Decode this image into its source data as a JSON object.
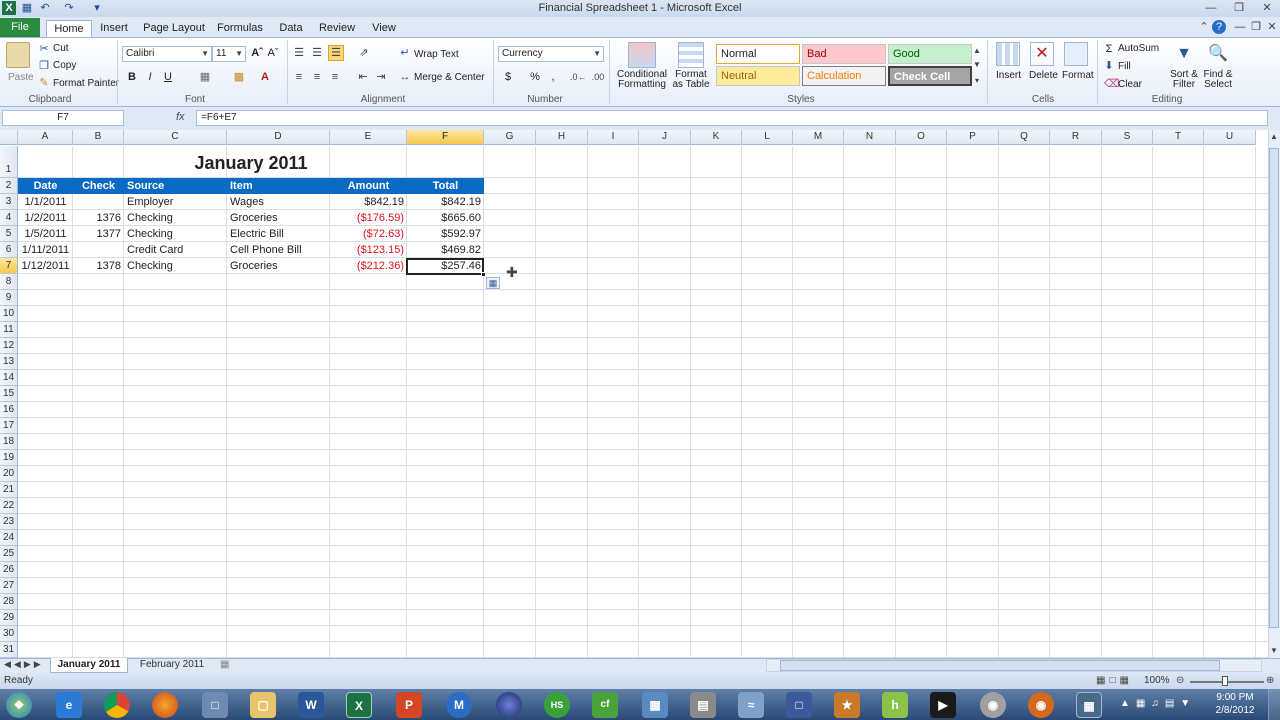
{
  "window": {
    "title": "Financial Spreadsheet 1 - Microsoft Excel"
  },
  "quick_access": {
    "save_icon": "save-icon",
    "undo_icon": "undo-icon",
    "redo_icon": "redo-icon"
  },
  "tabs": [
    {
      "label": "File"
    },
    {
      "label": "Home"
    },
    {
      "label": "Insert"
    },
    {
      "label": "Page Layout"
    },
    {
      "label": "Formulas"
    },
    {
      "label": "Data"
    },
    {
      "label": "Review"
    },
    {
      "label": "View"
    }
  ],
  "ribbon": {
    "clipboard": {
      "paste": "Paste",
      "cut": "Cut",
      "copy": "Copy",
      "format_painter": "Format Painter",
      "label": "Clipboard"
    },
    "font": {
      "name": "Calibri",
      "size": "11",
      "bold": "B",
      "italic": "I",
      "underline": "U",
      "label": "Font"
    },
    "alignment": {
      "wrap_text": "Wrap Text",
      "merge_center": "Merge & Center",
      "label": "Alignment"
    },
    "number": {
      "format": "Currency",
      "currency_symbol": "$",
      "percent": "%",
      "comma": ",",
      "label": "Number"
    },
    "styles": {
      "conditional_formatting": "Conditional Formatting",
      "format_as_table": "Format as Table",
      "normal": "Normal",
      "bad": "Bad",
      "good": "Good",
      "neutral": "Neutral",
      "calculation": "Calculation",
      "check_cell": "Check Cell",
      "label": "Styles"
    },
    "cells": {
      "insert": "Insert",
      "delete": "Delete",
      "format": "Format",
      "label": "Cells"
    },
    "editing": {
      "autosum": "AutoSum",
      "fill": "Fill",
      "clear": "Clear",
      "sort_filter": "Sort & Filter",
      "find_select": "Find & Select",
      "label": "Editing"
    }
  },
  "formula_bar": {
    "name_box": "F7",
    "fx": "fx",
    "formula": "=F6+E7"
  },
  "columns": [
    "A",
    "B",
    "C",
    "D",
    "E",
    "F",
    "G",
    "H",
    "I",
    "J",
    "K",
    "L",
    "M",
    "N",
    "O",
    "P",
    "Q",
    "R",
    "S",
    "T",
    "U"
  ],
  "rows": [
    "1",
    "2",
    "3",
    "4",
    "5",
    "6",
    "7",
    "8",
    "9",
    "10",
    "11",
    "12",
    "13",
    "14",
    "15",
    "16",
    "17",
    "18",
    "19",
    "20",
    "21",
    "22",
    "23",
    "24",
    "25",
    "26",
    "27",
    "28",
    "29",
    "30",
    "31"
  ],
  "sheet": {
    "title": "January 2011",
    "headers": [
      "Date",
      "Check",
      "Source",
      "Item",
      "Amount",
      "Total"
    ],
    "rows": [
      {
        "date": "1/1/2011",
        "check": "",
        "source": "Employer",
        "item": "Wages",
        "amount": "$842.19",
        "total": "$842.19",
        "negative": false
      },
      {
        "date": "1/2/2011",
        "check": "1376",
        "source": "Checking",
        "item": "Groceries",
        "amount": "($176.59)",
        "total": "$665.60",
        "negative": true
      },
      {
        "date": "1/5/2011",
        "check": "1377",
        "source": "Checking",
        "item": "Electric Bill",
        "amount": "($72.63)",
        "total": "$592.97",
        "negative": true
      },
      {
        "date": "1/11/2011",
        "check": "",
        "source": "Credit Card",
        "item": "Cell Phone Bill",
        "amount": "($123.15)",
        "total": "$469.82",
        "negative": true
      },
      {
        "date": "1/12/2011",
        "check": "1378",
        "source": "Checking",
        "item": "Groceries",
        "amount": "($212.36)",
        "total": "$257.46",
        "negative": true
      }
    ]
  },
  "sheet_tabs": [
    {
      "label": "January 2011"
    },
    {
      "label": "February 2011"
    }
  ],
  "status": {
    "ready": "Ready",
    "zoom": "100%"
  },
  "clock": {
    "time": "9:00 PM",
    "date": "2/8/2012"
  },
  "colors": {
    "header_blue": "#0b6bc4",
    "negative_red": "#e0141e",
    "file_green": "#2a8a3e"
  }
}
